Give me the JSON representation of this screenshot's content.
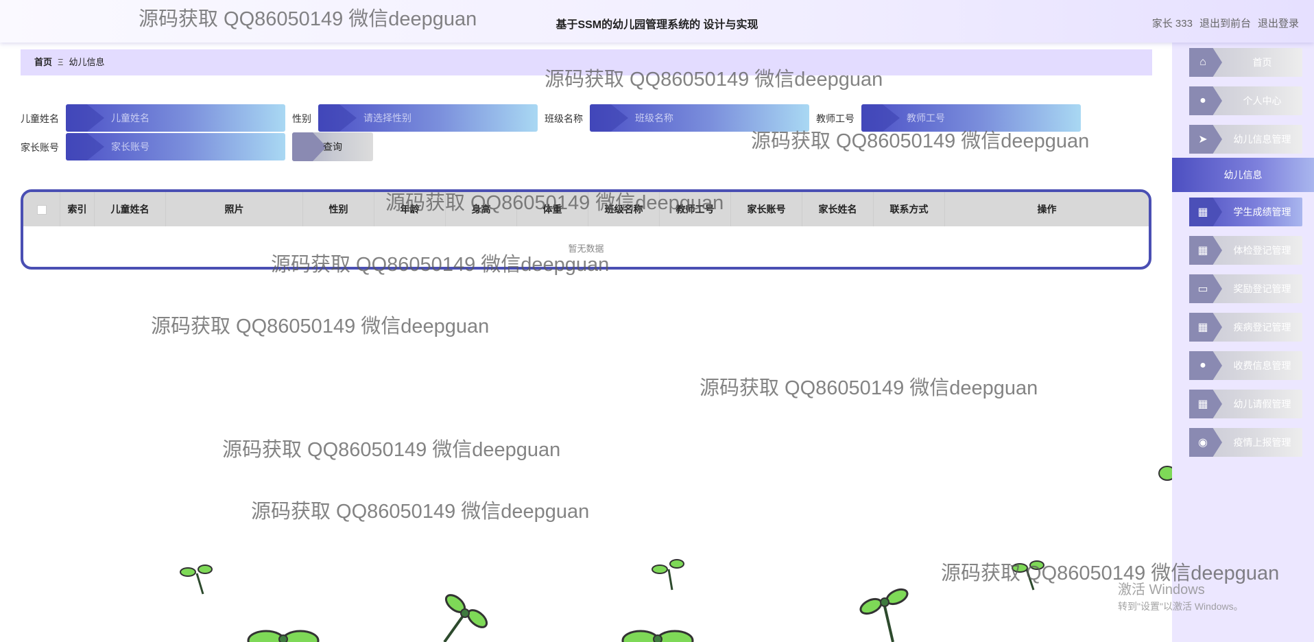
{
  "header": {
    "title": "基于SSM的幼儿园管理系统的 设计与实现",
    "user": "家长 333",
    "to_front": "退出到前台",
    "logout": "退出登录"
  },
  "breadcrumb": {
    "home": "首页",
    "sep": "Ξ",
    "current": "幼儿信息"
  },
  "search": {
    "child_name": {
      "label": "儿童姓名",
      "placeholder": "儿童姓名"
    },
    "gender": {
      "label": "性别",
      "placeholder": "请选择性别"
    },
    "class_name": {
      "label": "班级名称",
      "placeholder": "班级名称"
    },
    "teacher_no": {
      "label": "教师工号",
      "placeholder": "教师工号"
    },
    "parent_account": {
      "label": "家长账号",
      "placeholder": "家长账号"
    },
    "query_label": "查询"
  },
  "table": {
    "columns": [
      "",
      "索引",
      "儿童姓名",
      "照片",
      "性别",
      "年龄",
      "身高",
      "体重",
      "班级名称",
      "教师工号",
      "家长账号",
      "家长姓名",
      "联系方式",
      "操作"
    ],
    "empty_text": "暂无数据"
  },
  "sidebar": {
    "items": [
      {
        "label": "首页",
        "icon": "home-icon",
        "glyph": "⌂"
      },
      {
        "label": "个人中心",
        "icon": "user-icon",
        "glyph": "●"
      },
      {
        "label": "幼儿信息管理",
        "icon": "send-icon",
        "glyph": "➤"
      },
      {
        "label": "学生成绩管理",
        "icon": "grid-icon",
        "glyph": "▦"
      },
      {
        "label": "体检登记管理",
        "icon": "grid-icon",
        "glyph": "▦"
      },
      {
        "label": "奖励登记管理",
        "icon": "monitor-icon",
        "glyph": "▭"
      },
      {
        "label": "疾病登记管理",
        "icon": "grid-icon",
        "glyph": "▦"
      },
      {
        "label": "收费信息管理",
        "icon": "user-icon",
        "glyph": "●"
      },
      {
        "label": "幼儿请假管理",
        "icon": "grid-icon",
        "glyph": "▦"
      },
      {
        "label": "疫情上报管理",
        "icon": "bulb-icon",
        "glyph": "◉"
      }
    ],
    "active_sub": "幼儿信息"
  },
  "watermark": "源码获取 QQ86050149 微信deepguan",
  "windows_activation": {
    "line1": "激活 Windows",
    "line2": "转到\"设置\"以激活 Windows。"
  }
}
